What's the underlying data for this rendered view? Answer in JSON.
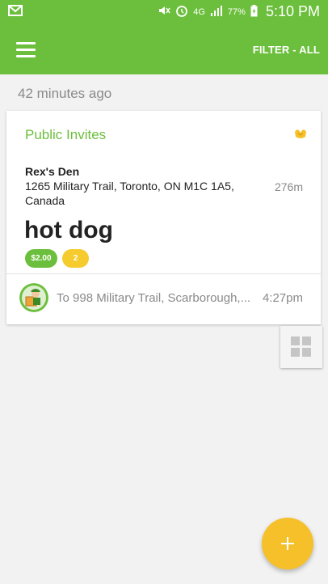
{
  "status_bar": {
    "battery": "77%",
    "network": "4G",
    "time": "5:10 PM",
    "icons": [
      "mail-icon",
      "mute-icon",
      "alarm-icon",
      "signal-icon",
      "battery-icon"
    ]
  },
  "toolbar": {
    "menu_icon": "hamburger-menu-icon",
    "filter_label": "FILTER - ALL"
  },
  "feed": {
    "timestamp": "42 minutes ago",
    "cards": [
      {
        "category": "Public Invites",
        "category_icon": "hands-icon",
        "venue_name": "Rex's Den",
        "venue_address": "1265 Military Trail, Toronto, ON M1C 1A5, Canada",
        "distance": "276m",
        "item": "hot dog",
        "price": "$2.00",
        "quantity": "2",
        "destination": "To 998 Military Trail, Scarborough,...",
        "destination_time": "4:27pm",
        "avatar_icon": "delivery-person-avatar"
      }
    ]
  },
  "actions": {
    "grid_view_icon": "grid-view-icon",
    "add_icon": "plus-icon"
  },
  "colors": {
    "primary": "#6cbf3c",
    "accent": "#f5c02a",
    "background": "#f2f2f2"
  }
}
